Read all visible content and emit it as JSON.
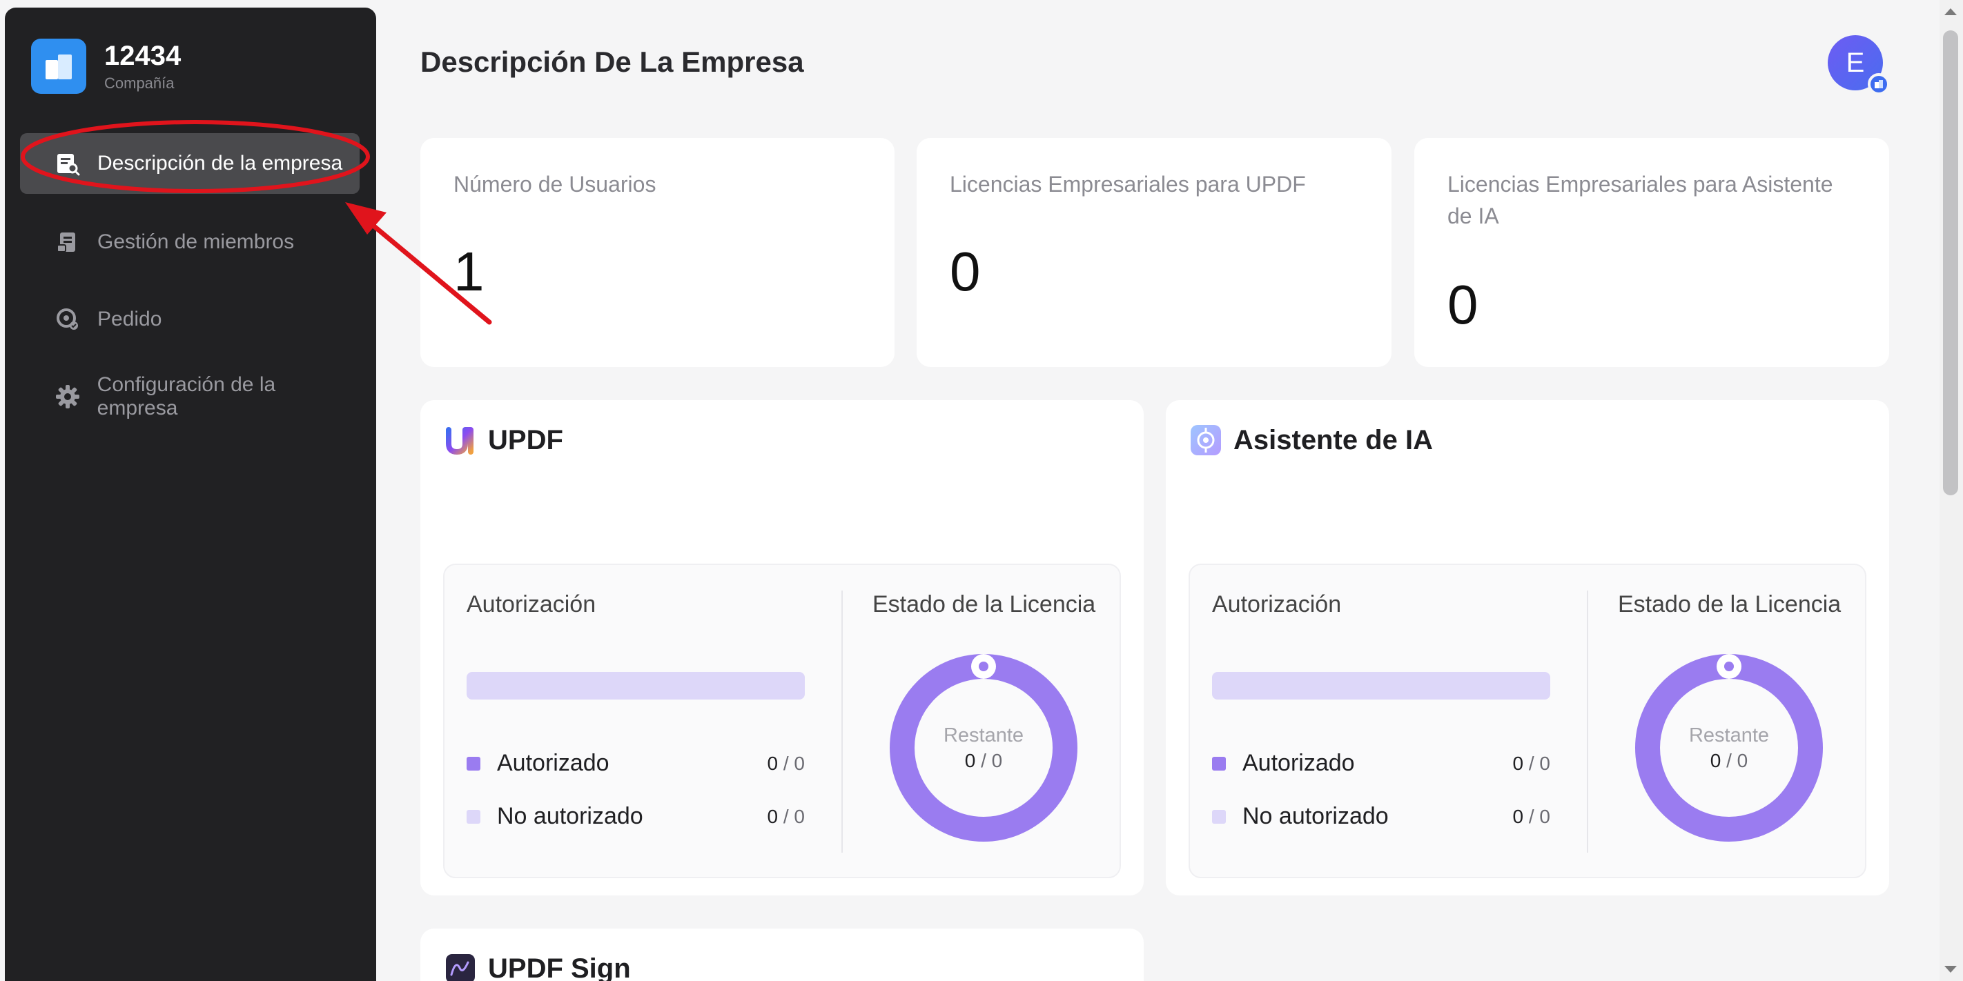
{
  "sidebar": {
    "company": {
      "name": "12434",
      "subtitle": "Compañía",
      "icon": "building-icon"
    },
    "items": [
      {
        "label": "Descripción de la empresa",
        "icon": "company-overview-icon",
        "active": true
      },
      {
        "label": "Gestión de miembros",
        "icon": "members-icon",
        "active": false
      },
      {
        "label": "Pedido",
        "icon": "order-icon",
        "active": false
      },
      {
        "label": "Configuración de la empresa",
        "icon": "gear-icon",
        "active": false
      }
    ]
  },
  "header": {
    "title": "Descripción De La Empresa",
    "avatar_letter": "E"
  },
  "stats": [
    {
      "label": "Número de Usuarios",
      "value": "1"
    },
    {
      "label": "Licencias Empresariales para UPDF",
      "value": "0"
    },
    {
      "label": "Licencias Empresariales para Asistente de IA",
      "value": "0"
    }
  ],
  "products": [
    {
      "title": "UPDF",
      "icon": "updf-logo-icon",
      "auth_label": "Autorización",
      "status_label": "Estado de la Licencia",
      "authorized_fraction": 0,
      "legend": [
        {
          "name": "Autorizado",
          "used": "0",
          "total": "/ 0",
          "color": "#9a7cf0"
        },
        {
          "name": "No autorizado",
          "used": "0",
          "total": "/ 0",
          "color": "#ddd7f9"
        }
      ],
      "donut": {
        "label": "Restante",
        "used": "0",
        "total": "/ 0"
      }
    },
    {
      "title": "Asistente de IA",
      "icon": "ai-assistant-icon",
      "auth_label": "Autorización",
      "status_label": "Estado de la Licencia",
      "authorized_fraction": 0,
      "legend": [
        {
          "name": "Autorizado",
          "used": "0",
          "total": "/ 0",
          "color": "#9a7cf0"
        },
        {
          "name": "No autorizado",
          "used": "0",
          "total": "/ 0",
          "color": "#ddd7f9"
        }
      ],
      "donut": {
        "label": "Restante",
        "used": "0",
        "total": "/ 0"
      }
    }
  ],
  "sign_card": {
    "title": "UPDF Sign",
    "icon": "updf-sign-icon"
  },
  "colors": {
    "sidebar_bg": "#212123",
    "active_item": "#4a4a4d",
    "accent_purple": "#9a7cf0",
    "light_purple": "#ddd7f9",
    "annotation_red": "#e0141c"
  }
}
